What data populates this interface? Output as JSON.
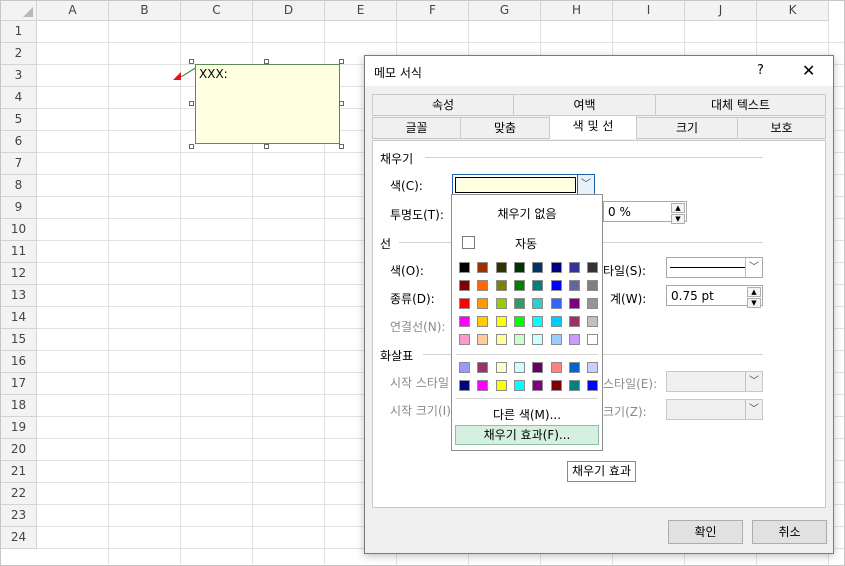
{
  "sheet": {
    "columns": [
      "A",
      "B",
      "C",
      "D",
      "E",
      "F",
      "G",
      "H",
      "I",
      "J",
      "K"
    ],
    "rows": [
      "1",
      "2",
      "3",
      "4",
      "5",
      "6",
      "7",
      "8",
      "9",
      "10",
      "11",
      "12",
      "13",
      "14",
      "15",
      "16",
      "17",
      "18",
      "19",
      "20",
      "21",
      "22",
      "23",
      "24"
    ]
  },
  "comment": {
    "text": "XXX:"
  },
  "dialog": {
    "title": "메모 서식",
    "help": "?",
    "close": "✕",
    "tabs_row1": [
      "속성",
      "여백",
      "대체 텍스트"
    ],
    "tabs_row2": [
      "글꼴",
      "맞춤",
      "색 및 선",
      "크기",
      "보호"
    ],
    "fill": {
      "section": "채우기",
      "color_label": "색(C):",
      "transparency_label": "투명도(T):",
      "transparency_value": "0 %"
    },
    "line": {
      "section": "선",
      "color_label": "색(O):",
      "type_label": "종류(D):",
      "connector_label": "연결선(N):",
      "style_label": "타일(S):",
      "weight_label": "계(W):",
      "weight_value": "0.75 pt"
    },
    "arrows": {
      "section": "화살표",
      "begin_style_label": "시작 스타일",
      "end_style_label": "스타일(E):",
      "begin_size_label": "시작 크기(I)",
      "end_size_label": "크기(Z):"
    },
    "ok": "확인",
    "cancel": "취소"
  },
  "color_popup": {
    "no_fill": "채우기 없음",
    "automatic": "자동",
    "more_colors": "다른 색(M)...",
    "fill_effects": "채우기 효과(F)...",
    "palette": [
      [
        "#000000",
        "#993300",
        "#333300",
        "#003300",
        "#003366",
        "#000080",
        "#333399",
        "#333333"
      ],
      [
        "#800000",
        "#FF6600",
        "#808000",
        "#008000",
        "#008080",
        "#0000FF",
        "#666699",
        "#808080"
      ],
      [
        "#FF0000",
        "#FF9900",
        "#99CC00",
        "#339966",
        "#33CCCC",
        "#3366FF",
        "#800080",
        "#969696"
      ],
      [
        "#FF00FF",
        "#FFCC00",
        "#FFFF00",
        "#00FF00",
        "#00FFFF",
        "#00CCFF",
        "#993366",
        "#C0C0C0"
      ],
      [
        "#FF99CC",
        "#FFCC99",
        "#FFFF99",
        "#CCFFCC",
        "#CCFFFF",
        "#99CCFF",
        "#CC99FF",
        "#FFFFFF"
      ]
    ],
    "extra": [
      [
        "#9999FF",
        "#993366",
        "#FFFFCC",
        "#CCFFFF",
        "#660066",
        "#FF8080",
        "#0066CC",
        "#CCCCFF"
      ],
      [
        "#000080",
        "#FF00FF",
        "#FFFF00",
        "#00FFFF",
        "#800080",
        "#800000",
        "#008080",
        "#0000FF"
      ]
    ]
  },
  "tooltip": "채우기 효과",
  "colors": {
    "comment_fill": "#FFFFE1",
    "hover_fill": "#D5EFE1",
    "selected_border": "#1F5FA8"
  }
}
